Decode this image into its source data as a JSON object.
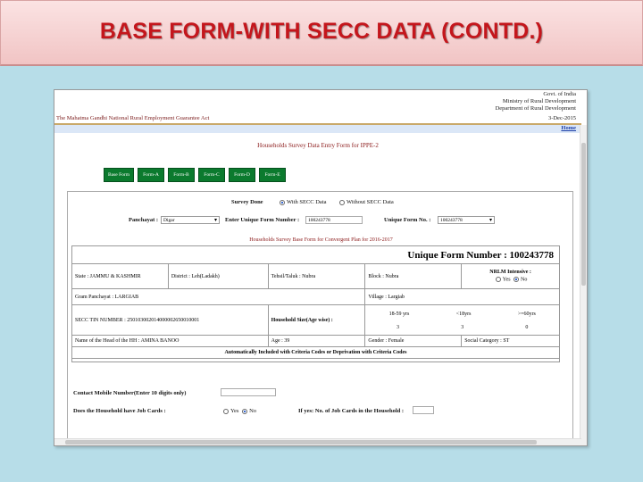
{
  "slide": {
    "title": "BASE FORM-WITH  SECC DATA (CONTD.)"
  },
  "header": {
    "gov_lines": [
      "Govt. of India",
      "Ministry of Rural Development",
      "Department of Rural Development"
    ],
    "act_title": "The Mahatma Gandhi National Rural Employment Guarantee Act",
    "date": "3-Dec-2015",
    "home_link": "Home"
  },
  "page_title": "Households Survey Data Entry Form for IPPE-2",
  "tabs": [
    "Base Form",
    "Form-A",
    "Form-B",
    "Form-C",
    "Form-D",
    "Form-E"
  ],
  "survey": {
    "label": "Survey Done",
    "opt_with": "With SECC Data",
    "opt_without": "Without SECC Data"
  },
  "panchayat": {
    "label": "Panchayat :",
    "value": "Digar"
  },
  "unique_entry": {
    "label": "Enter Unique Form Number :",
    "value": "100243778"
  },
  "unique_select": {
    "label": "Unique Form No. :",
    "value": "100243778"
  },
  "subhead": "Households Survey Base Form for Convergent Plan for 2016-2017",
  "unique_form_number": "Unique Form Number : 100243778",
  "grid": {
    "state": "State : JAMMU & KASHMIR",
    "district": "District : Leh(Ladakh)",
    "tehsil": "Tehsil/Taluk : Nubra",
    "block": "Block : Nubra",
    "nrlm_label": "NRLM Intensive :",
    "nrlm_yes": "Yes",
    "nrlm_no": "No",
    "gram_panchayat": "Gram Panchayat : LARGIAB",
    "village": "Village : Largiab",
    "secc_tin": "SECC TIN NUMBER : 250103002014000002650010001",
    "hh_size_label": "Household Size(Age wise) :",
    "age_heads": [
      "18-59 yrs",
      "<18yrs",
      ">=60yrs"
    ],
    "age_values": [
      "3",
      "3",
      "0"
    ],
    "head_name": "Name of the Head of the HH : AMINA BANOO",
    "age": "Age : 39",
    "gender": "Gender : Female",
    "social_category": "Social Category : ST",
    "auto_included": "Automatically Included with Criteria Codes or Deprivation with Criteria Codes"
  },
  "contact": {
    "label": "Contact Mobile Number(Enter 10 digits only)",
    "value": ""
  },
  "job_cards": {
    "label": "Does the Household have Job Cards :",
    "yes": "Yes",
    "no": "No",
    "count_label": "If yes: No. of Job Cards in the Household :",
    "count_value": ""
  }
}
